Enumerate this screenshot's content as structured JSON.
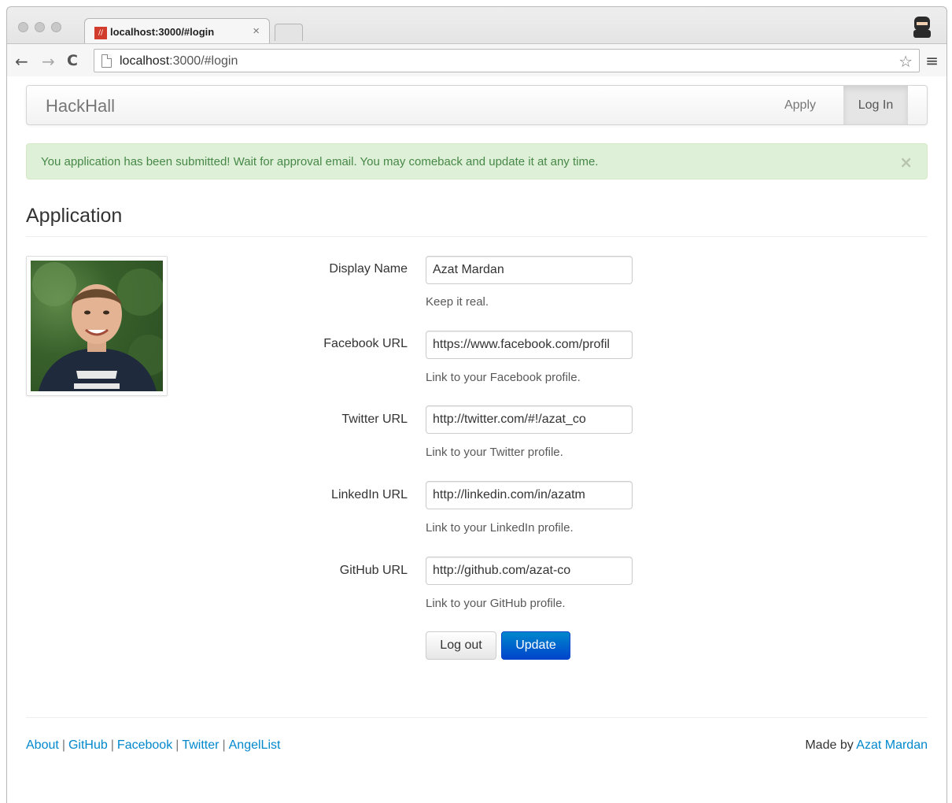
{
  "browser": {
    "tab_title": "localhost:3000/#login",
    "tab_close": "×",
    "favicon_text": "//",
    "url_host": "localhost",
    "url_rest": ":3000/#login",
    "icons": [
      "back-arrow-icon",
      "forward-arrow-icon",
      "reload-icon",
      "page-icon",
      "star-icon",
      "menu-icon",
      "ninja-icon"
    ]
  },
  "navbar": {
    "brand": "HackHall",
    "apply": "Apply",
    "login": "Log In"
  },
  "alert": {
    "message": "You application has been submitted! Wait for approval email. You may comeback and update it at any time.",
    "close": "×",
    "color": "#dff0d8"
  },
  "page": {
    "title": "Application"
  },
  "form": {
    "display_name": {
      "label": "Display Name",
      "value": "Azat Mardan",
      "help": "Keep it real."
    },
    "facebook": {
      "label": "Facebook URL",
      "value": "https://www.facebook.com/profil",
      "help": "Link to your Facebook profile."
    },
    "twitter": {
      "label": "Twitter URL",
      "value": "http://twitter.com/#!/azat_co",
      "help": "Link to your Twitter profile."
    },
    "linkedin": {
      "label": "LinkedIn URL",
      "value": "http://linkedin.com/in/azatm",
      "help": "Link to your LinkedIn profile."
    },
    "github": {
      "label": "GitHub URL",
      "value": "http://github.com/azat-co",
      "help": "Link to your GitHub profile."
    },
    "logout_label": "Log out",
    "update_label": "Update"
  },
  "footer": {
    "links": [
      "About",
      "GitHub",
      "Facebook",
      "Twitter",
      "AngelList"
    ],
    "separator": "|",
    "credit_prefix": "Made by",
    "credit_name": "Azat Mardan",
    "link_color": "#0088cc"
  }
}
